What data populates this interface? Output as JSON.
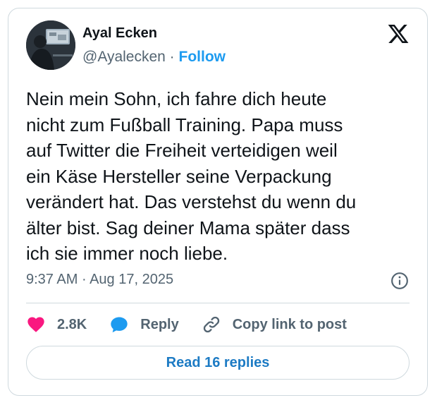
{
  "author": {
    "name": "Ayal Ecken",
    "handle": "@Ayalecken",
    "separator": "·",
    "follow_label": "Follow"
  },
  "tweet": {
    "text": "Nein mein Sohn, ich fahre dich heute\nnicht zum Fußball Training. Papa muss\nauf Twitter die Freiheit verteidigen weil\nein Käse Hersteller seine Verpackung\nverändert hat. Das verstehst du wenn du\nälter bist. Sag deiner Mama später dass\nich sie immer noch liebe.",
    "time": "9:37 AM",
    "separator": "·",
    "date": "Aug 17, 2025"
  },
  "actions": {
    "likes_count": "2.8K",
    "reply_label": "Reply",
    "copy_link_label": "Copy link to post"
  },
  "read_replies_label": "Read 16 replies",
  "icons": {
    "platform_logo": "x-logo-icon",
    "info": "info-icon",
    "like": "heart-icon",
    "reply": "speech-bubble-icon",
    "copy_link": "link-icon"
  },
  "colors": {
    "accent": "#1d9bf0",
    "heart": "#f91880",
    "reply_icon": "#1d9bf0",
    "text_primary": "#0f1419",
    "text_secondary": "#536471",
    "border": "#cfd9de"
  }
}
